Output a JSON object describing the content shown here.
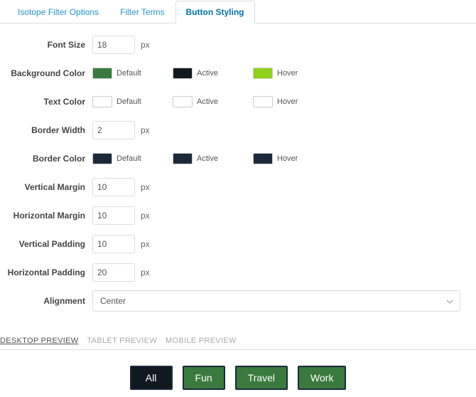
{
  "tabs": {
    "items": [
      {
        "label": "Isotope Filter Options",
        "active": false
      },
      {
        "label": "Filter Terms",
        "active": false
      },
      {
        "label": "Button Styling",
        "active": true
      }
    ]
  },
  "labels": {
    "font_size": "Font Size",
    "background_color": "Background Color",
    "text_color": "Text Color",
    "border_width": "Border Width",
    "border_color": "Border Color",
    "vertical_margin": "Vertical Margin",
    "horizontal_margin": "Horizontal Margin",
    "vertical_padding": "Vertical Padding",
    "horizontal_padding": "Horizontal Padding",
    "alignment": "Alignment",
    "unit_px": "px",
    "state_default": "Default",
    "state_active": "Active",
    "state_hover": "Hover"
  },
  "values": {
    "font_size": "18",
    "border_width": "2",
    "vertical_margin": "10",
    "horizontal_margin": "10",
    "vertical_padding": "10",
    "horizontal_padding": "20",
    "alignment": "Center"
  },
  "colors": {
    "background": {
      "default": "#3a7a3f",
      "active": "#101820",
      "hover": "#8ed21a"
    },
    "text": {
      "default": "#ffffff",
      "active": "#ffffff",
      "hover": "#ffffff"
    },
    "border": {
      "default": "#1b2a3a",
      "active": "#1b2a3a",
      "hover": "#1b2a3a"
    }
  },
  "preview_tabs": {
    "items": [
      {
        "label": "DESKTOP PREVIEW",
        "active": true
      },
      {
        "label": "TABLET PREVIEW",
        "active": false
      },
      {
        "label": "MOBILE PREVIEW",
        "active": false
      }
    ]
  },
  "filter_buttons": {
    "items": [
      {
        "label": "All",
        "active": true
      },
      {
        "label": "Fun",
        "active": false
      },
      {
        "label": "Travel",
        "active": false
      },
      {
        "label": "Work",
        "active": false
      }
    ]
  }
}
